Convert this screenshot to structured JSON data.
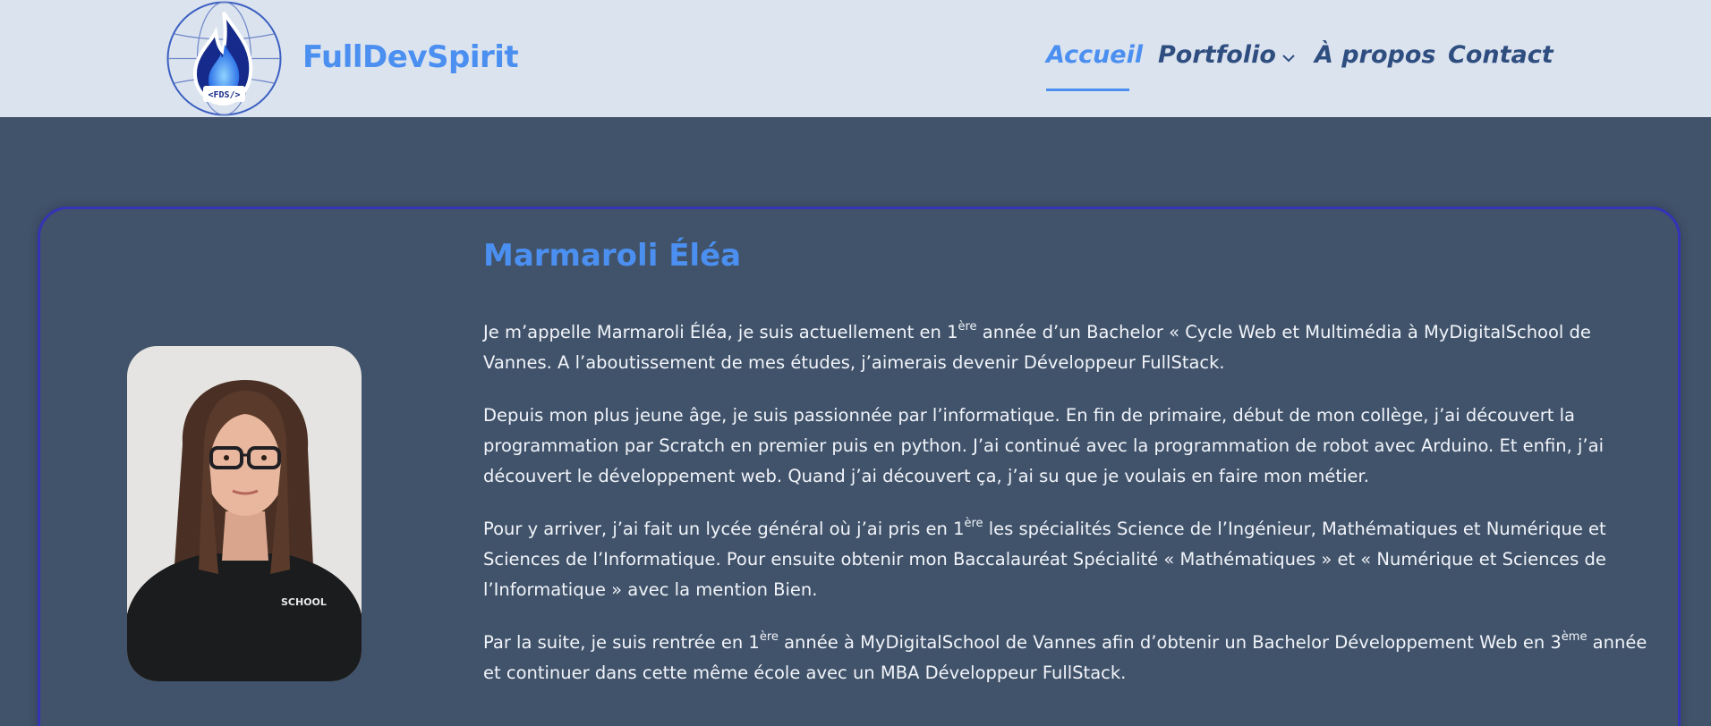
{
  "header": {
    "brand": "FullDevSpirit",
    "logo_text": "<FDS/>",
    "nav": [
      {
        "label": "Accueil",
        "active": true
      },
      {
        "label": "Portfolio",
        "has_dropdown": true
      },
      {
        "label": "À propos"
      },
      {
        "label": "Contact"
      }
    ]
  },
  "profile": {
    "name": "Marmaroli Éléa",
    "paragraphs": [
      {
        "a": "Je m’appelle Marmaroli Éléa, je suis actuellement en 1",
        "sup1": "ère",
        "b": " année d’un Bachelor « Cycle Web et Multimédia à MyDigitalSchool de Vannes. A l’aboutissement de mes études, j’aimerais devenir Développeur FullStack."
      },
      {
        "text": "Depuis mon plus jeune âge, je suis passionnée par l’informatique. En fin de primaire, début de mon collège, j’ai découvert la programmation par Scratch en premier puis en python. J’ai continué avec la programmation de robot avec Arduino. Et enfin, j’ai découvert le développement web. Quand j’ai découvert ça, j’ai su que je voulais en faire mon métier."
      },
      {
        "a": "Pour y arriver, j’ai fait un lycée général où j’ai pris en 1",
        "sup1": "ère",
        "b": " les spécialités Science de l’Ingénieur, Mathématiques et Numérique et Sciences de l’Informatique. Pour ensuite obtenir mon Baccalauréat Spécialité « Mathématiques » et « Numérique et Sciences de l’Informatique » avec la mention Bien."
      },
      {
        "a": "Par la suite, je suis rentrée en 1",
        "sup1": "ère",
        "b": " année à MyDigitalSchool de Vannes afin d’obtenir un Bachelor Développement Web en 3",
        "sup2": "ème",
        "c": " année et continuer dans cette même école avec un MBA Développeur FullStack."
      }
    ],
    "photo_text": "SCHOOL"
  },
  "colors": {
    "accent": "#4b8ff0",
    "header_bg": "#dbe3ef",
    "page_bg": "#41536a",
    "nav_text": "#2f4e80",
    "card_border": "#3434b5"
  }
}
